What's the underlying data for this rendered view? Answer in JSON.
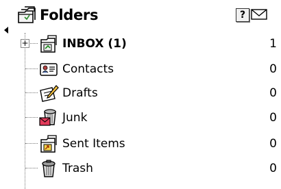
{
  "header": {
    "title": "Folders",
    "help_label": "?"
  },
  "folders": [
    {
      "name": "INBOX (1)",
      "count": "1",
      "icon": "inbox-icon"
    },
    {
      "name": "Contacts",
      "count": "0",
      "icon": "contacts-icon"
    },
    {
      "name": "Drafts",
      "count": "0",
      "icon": "drafts-icon"
    },
    {
      "name": "Junk",
      "count": "0",
      "icon": "junk-icon"
    },
    {
      "name": "Sent Items",
      "count": "0",
      "icon": "sent-items-icon"
    },
    {
      "name": "Trash",
      "count": "0",
      "icon": "trash-icon"
    }
  ]
}
